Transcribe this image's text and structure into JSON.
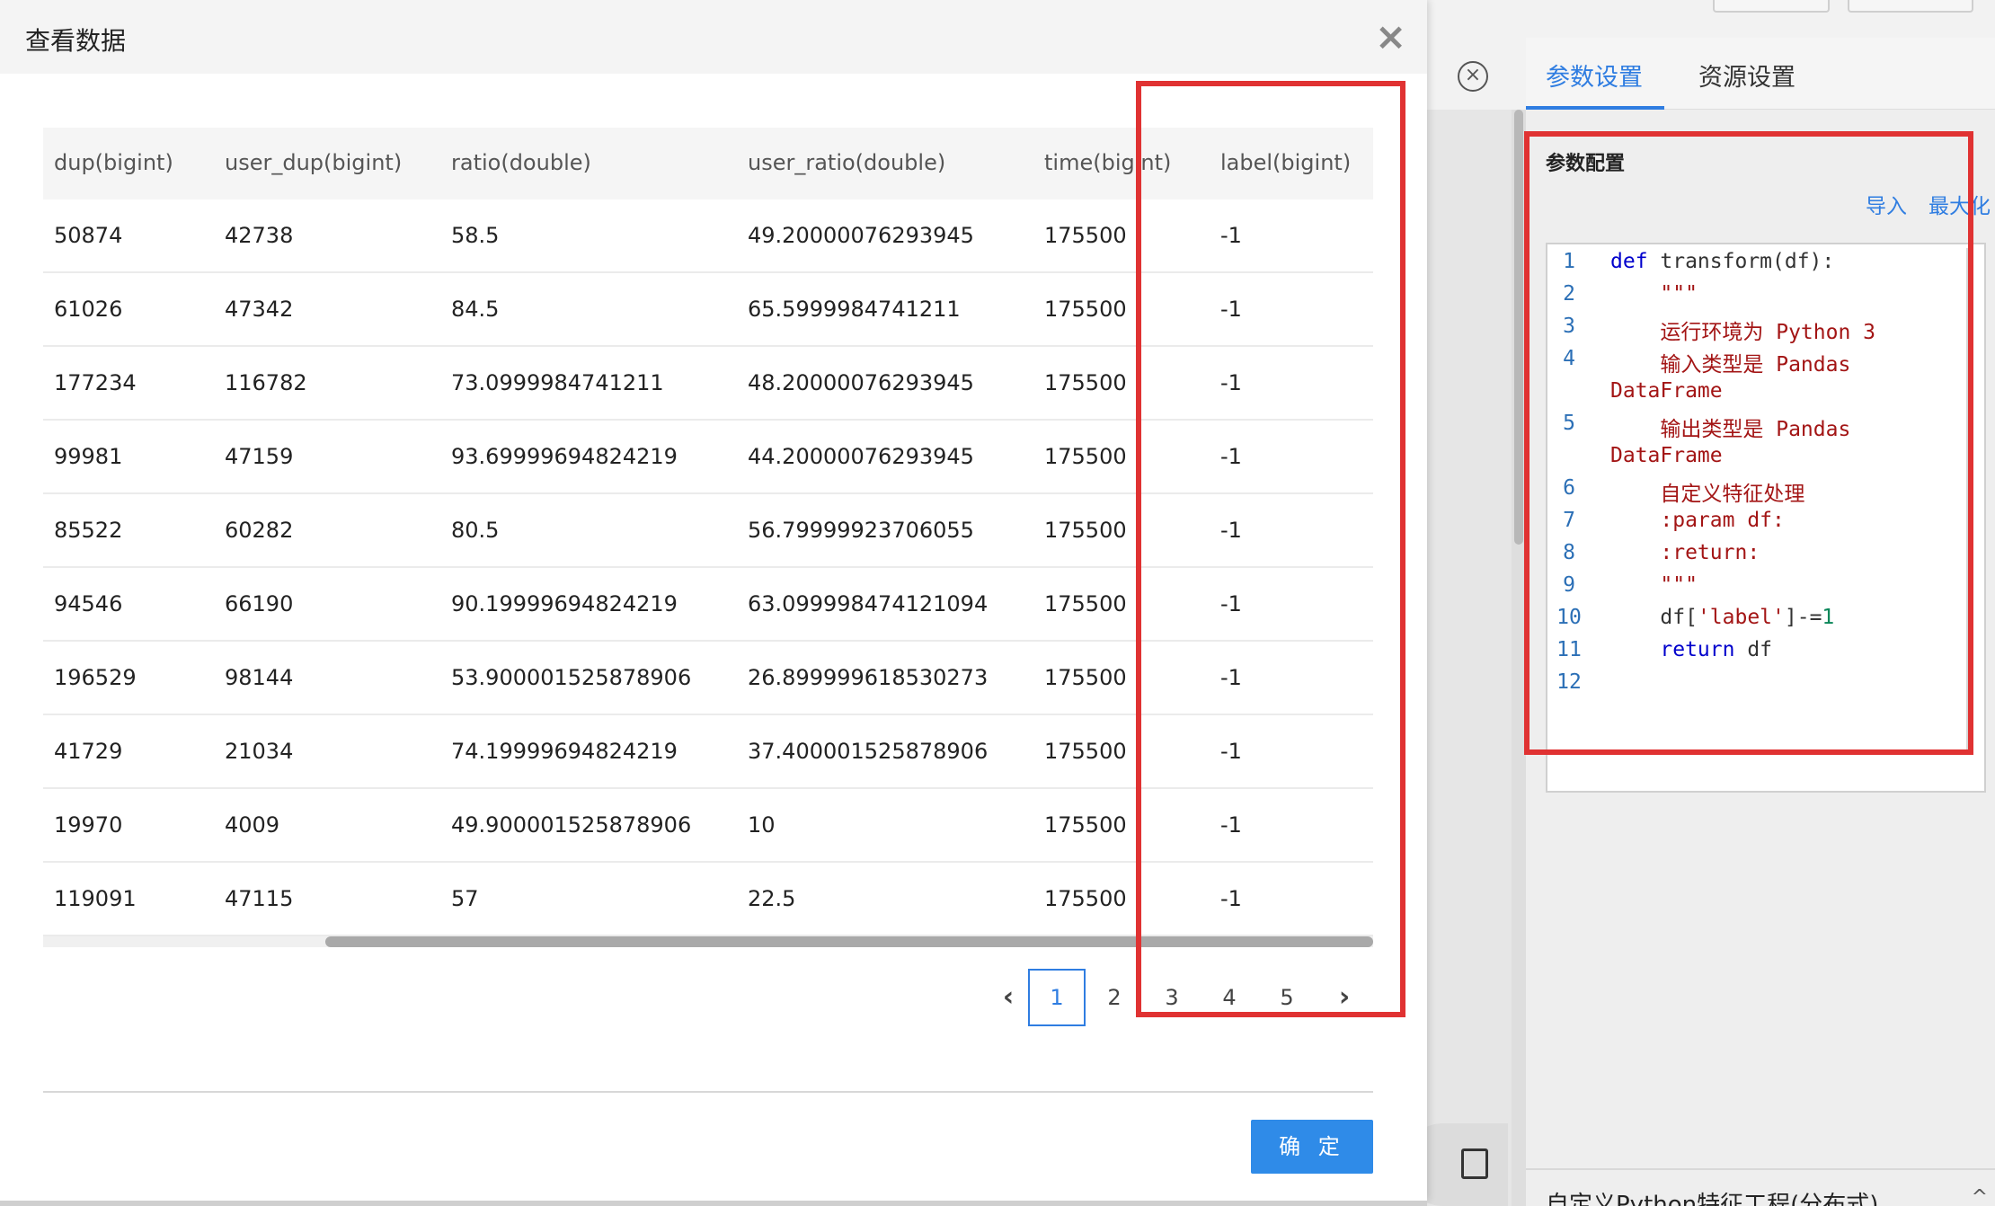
{
  "modal": {
    "title": "查看数据",
    "close_glyph": "×",
    "confirm_label": "确 定"
  },
  "table": {
    "columns": [
      "dup(bigint)",
      "user_dup(bigint)",
      "ratio(double)",
      "user_ratio(double)",
      "time(bigint)",
      "label(bigint)"
    ],
    "rows": [
      [
        "50874",
        "42738",
        "58.5",
        "49.20000076293945",
        "175500",
        "-1"
      ],
      [
        "61026",
        "47342",
        "84.5",
        "65.5999984741211",
        "175500",
        "-1"
      ],
      [
        "177234",
        "116782",
        "73.0999984741211",
        "48.20000076293945",
        "175500",
        "-1"
      ],
      [
        "99981",
        "47159",
        "93.69999694824219",
        "44.20000076293945",
        "175500",
        "-1"
      ],
      [
        "85522",
        "60282",
        "80.5",
        "56.79999923706055",
        "175500",
        "-1"
      ],
      [
        "94546",
        "66190",
        "90.19999694824219",
        "63.099998474121094",
        "175500",
        "-1"
      ],
      [
        "196529",
        "98144",
        "53.900001525878906",
        "26.899999618530273",
        "175500",
        "-1"
      ],
      [
        "41729",
        "21034",
        "74.19999694824219",
        "37.400001525878906",
        "175500",
        "-1"
      ],
      [
        "19970",
        "4009",
        "49.900001525878906",
        "10",
        "175500",
        "-1"
      ],
      [
        "119091",
        "47115",
        "57",
        "22.5",
        "175500",
        "-1"
      ]
    ]
  },
  "pagination": {
    "prev_glyph": "‹",
    "next_glyph": "›",
    "pages": [
      "1",
      "2",
      "3",
      "4",
      "5"
    ],
    "current": "1"
  },
  "side_panel": {
    "tabs": [
      "参数设置",
      "资源设置"
    ],
    "active_tab": "参数设置",
    "section_title": "参数配置",
    "import_label": "导入",
    "maximize_label": "最大化",
    "close_glyph": "×",
    "bottom_title": "自定义Python特征工程(分布式)",
    "collapse_glyph": "^"
  },
  "code": {
    "line_numbers": [
      "1",
      "2",
      "3",
      "4",
      "",
      "5",
      "",
      "6",
      "7",
      "8",
      "9",
      "10",
      "11",
      "12"
    ],
    "lines": [
      [
        {
          "t": "def",
          "c": "kw"
        },
        {
          "t": " transform(df):",
          "c": ""
        }
      ],
      [
        {
          "t": "    \"\"\"",
          "c": "str"
        }
      ],
      [
        {
          "t": "    运行环境为 Python 3",
          "c": "str"
        }
      ],
      [
        {
          "t": "    输入类型是 Pandas",
          "c": "str"
        }
      ],
      [
        {
          "t": "DataFrame",
          "c": "str"
        }
      ],
      [
        {
          "t": "    输出类型是 Pandas",
          "c": "str"
        }
      ],
      [
        {
          "t": "DataFrame",
          "c": "str"
        }
      ],
      [
        {
          "t": "    自定义特征处理",
          "c": "str"
        }
      ],
      [
        {
          "t": "    :param df:",
          "c": "str"
        }
      ],
      [
        {
          "t": "    :return:",
          "c": "str"
        }
      ],
      [
        {
          "t": "    \"\"\"",
          "c": "str"
        }
      ],
      [
        {
          "t": "    df[",
          "c": ""
        },
        {
          "t": "'label'",
          "c": "str"
        },
        {
          "t": "]-=",
          "c": ""
        },
        {
          "t": "1",
          "c": "num"
        }
      ],
      [
        {
          "t": "    ",
          "c": ""
        },
        {
          "t": "return",
          "c": "kw"
        },
        {
          "t": " df",
          "c": ""
        }
      ],
      []
    ]
  },
  "colors": {
    "accent": "#2f7de1",
    "annotation_red": "#e03232",
    "button_blue": "#2f8be8"
  }
}
